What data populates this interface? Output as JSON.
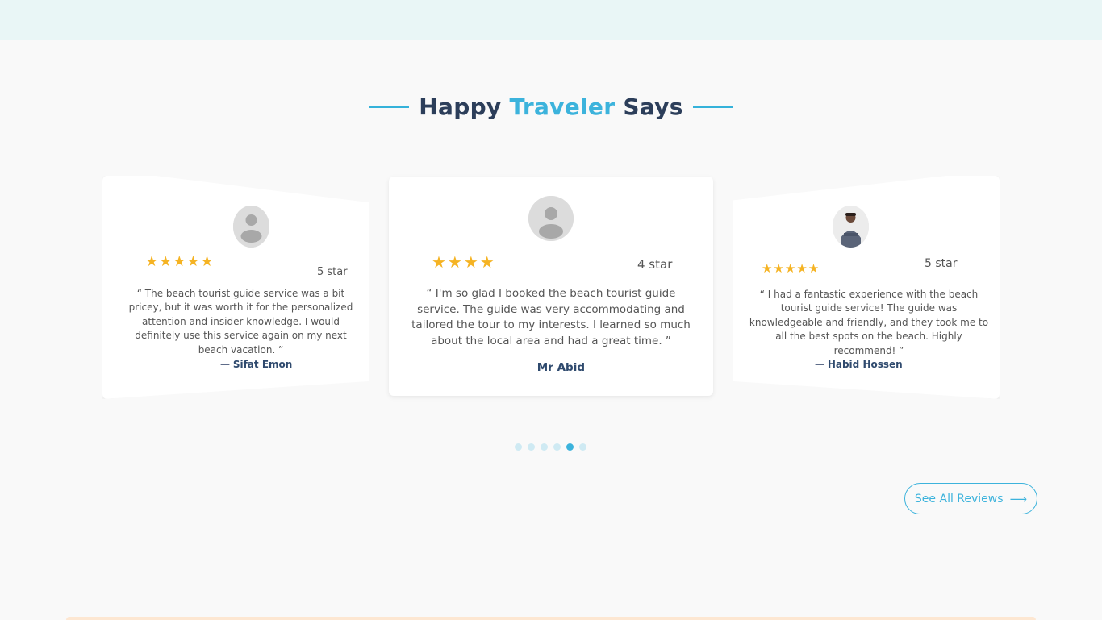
{
  "heading": {
    "prefix": "Happy",
    "accent": "Traveler",
    "suffix": "Says"
  },
  "reviews": [
    {
      "stars_visual": "★★★★★",
      "rating": 5,
      "star_label": "5 star",
      "quote": "“ The beach tourist guide service was a bit pricey, but it was worth it for the personalized attention and insider knowledge. I would definitely use this service again on my next beach vacation. ”",
      "author_dash": "—",
      "author": "Sifat Emon"
    },
    {
      "stars_visual": "★★★★",
      "rating": 4,
      "star_label": "4 star",
      "quote": "“ I'm so glad I booked the beach tourist guide service. The guide was very accommodating and tailored the tour to my interests. I learned so much about the local area and had a great time. ”",
      "author_dash": "—",
      "author": "Mr Abid"
    },
    {
      "stars_visual": "★★★★★",
      "rating": 5,
      "star_label": "5 star",
      "quote": "“ I had a fantastic experience with the beach tourist guide service! The guide was knowledgeable and friendly, and they took me to all the best spots on the beach. Highly recommend! ”",
      "author_dash": "—",
      "author": "Habid Hossen"
    }
  ],
  "carousel": {
    "total_dots": 6,
    "active_dot": 5
  },
  "see_all": {
    "label": "See All Reviews",
    "icon": "arrow-right-icon"
  },
  "colors": {
    "accent": "#3cb3dc",
    "heading": "#2c3e5a",
    "star": "#f5b323",
    "top_band": "#e9f6f6"
  }
}
